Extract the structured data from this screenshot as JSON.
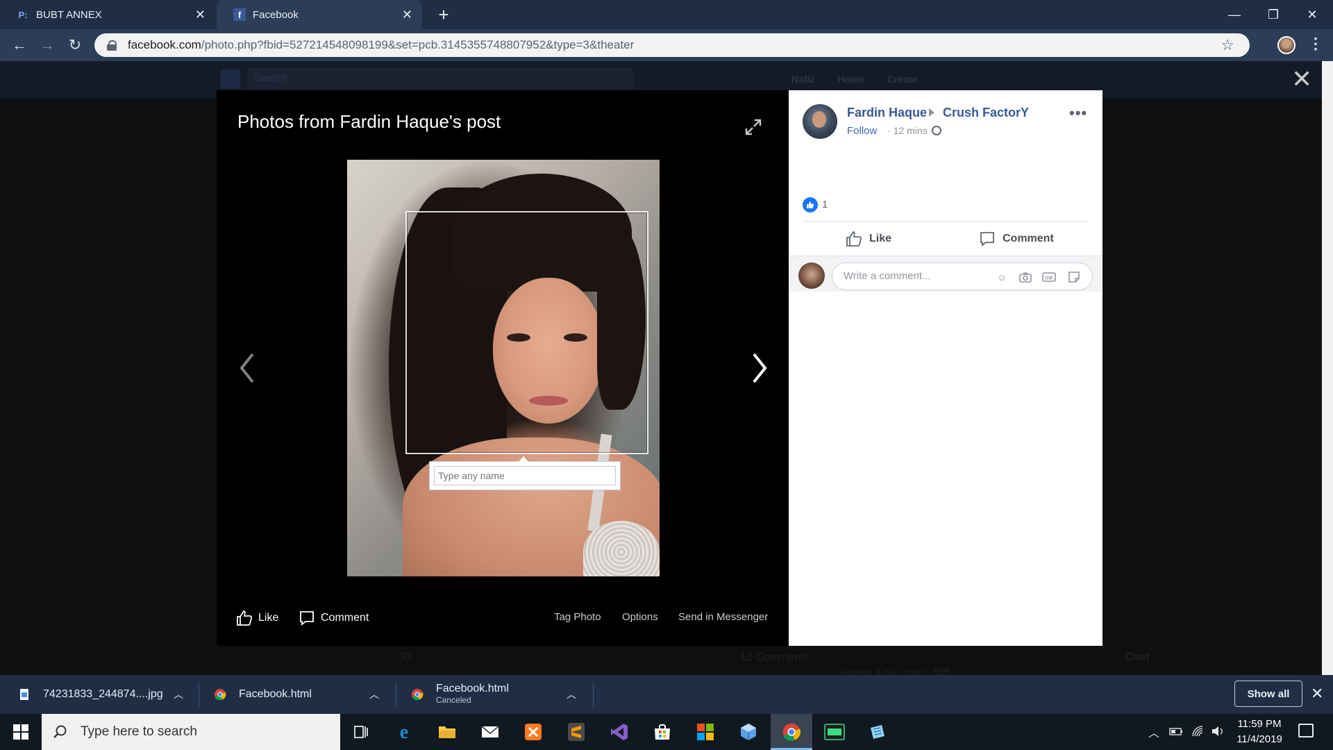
{
  "browser": {
    "tabs": [
      {
        "title": "BUBT ANNEX",
        "active": false
      },
      {
        "title": "Facebook",
        "active": true
      }
    ],
    "url_host": "facebook.com",
    "url_path": "/photo.php?fbid=527214548098199&set=pcb.3145355748807952&type=3&theater"
  },
  "fb_header": {
    "search_placeholder": "Search",
    "user_name": "Nafiz",
    "home": "Home",
    "create": "Create"
  },
  "viewer": {
    "title": "Photos from Fardin Haque's post",
    "tag_input_placeholder": "Type any name",
    "like_label": "Like",
    "comment_label": "Comment",
    "tag_photo": "Tag Photo",
    "options": "Options",
    "send_messenger": "Send in Messenger"
  },
  "post": {
    "author": "Fardin Haque",
    "group": "Crush FactorY",
    "follow": "Follow",
    "time": "12 mins",
    "reaction_count": "1",
    "like_label": "Like",
    "comment_label": "Comment",
    "comment_placeholder": "Write a comment..."
  },
  "background_page": {
    "reactions": "30",
    "comments": "12 Comments",
    "languages": "English (US) · বাংলা · हिंदी · ...",
    "chat": "Chat"
  },
  "downloads": [
    {
      "name": "74231833_244874....jpg",
      "status": ""
    },
    {
      "name": "Facebook.html",
      "status": ""
    },
    {
      "name": "Facebook.html",
      "status": "Canceled"
    }
  ],
  "download_show_all": "Show all",
  "taskbar": {
    "search_placeholder": "Type here to search",
    "time": "11:59 PM",
    "date": "11/4/2019"
  },
  "colors": {
    "fb_blue": "#385898",
    "like_blue": "#1877f2",
    "chrome_frame": "#1f2e45"
  }
}
